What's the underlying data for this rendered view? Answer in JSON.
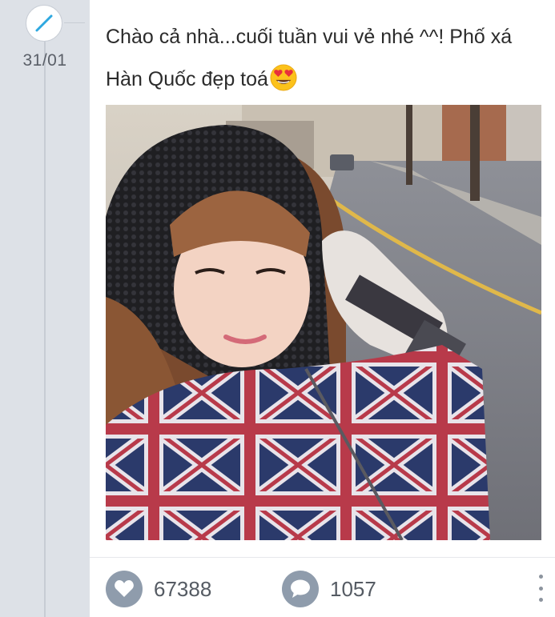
{
  "post": {
    "date": "31/01",
    "caption": "Chào cả nhà...cuối tuần vui vẻ nhé ^^! Phố xá Hàn Quốc đẹp toá",
    "type_icon": "pencil-icon",
    "emoji": "heart-eyes-emoji",
    "photo": "selfie-on-street",
    "likes": "67388",
    "comments": "1057"
  },
  "icons": {
    "like": "heart-icon",
    "comment": "speech-bubble-icon",
    "more": "vertical-dots-icon"
  },
  "colors": {
    "accent": "#2ea8e0",
    "rail": "#dde1e7",
    "icon_circle": "#8f9cac"
  }
}
